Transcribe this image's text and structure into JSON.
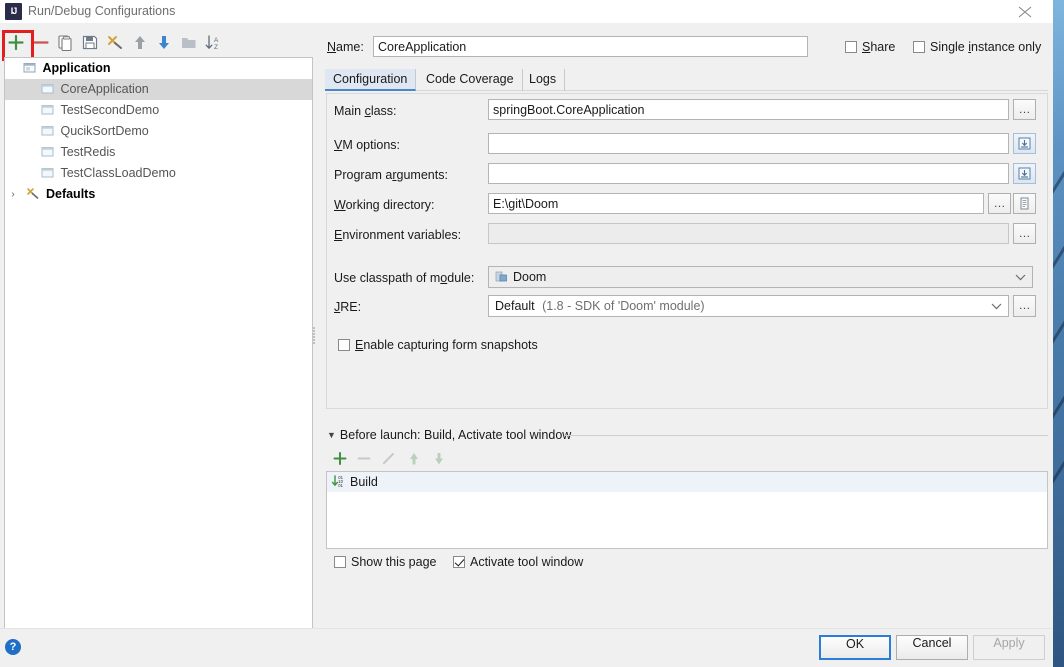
{
  "window": {
    "title": "Run/Debug Configurations",
    "app_icon": "intellij-idea-icon",
    "close_label": "×"
  },
  "tree_toolbar": {
    "buttons": [
      {
        "name": "add-configuration-button",
        "icon": "plus-icon",
        "color": "#3d9140"
      },
      {
        "name": "remove-configuration-button",
        "icon": "minus-icon",
        "color": "#c75450"
      },
      {
        "name": "copy-configuration-button",
        "icon": "copy-icon",
        "color": "#7a7a7a"
      },
      {
        "name": "save-configuration-button",
        "icon": "save-icon",
        "color": "#6e7b8b"
      },
      {
        "name": "edit-defaults-button",
        "icon": "wrench-icon",
        "color": "#d1a33a"
      },
      {
        "name": "move-up-button",
        "icon": "arrow-up-icon",
        "color": "#9aa0a6"
      },
      {
        "name": "move-down-button",
        "icon": "arrow-down-icon",
        "color": "#3b86d0"
      },
      {
        "name": "move-into-folder-button",
        "icon": "folder-icon",
        "color": "#9aa0a6"
      },
      {
        "name": "sort-configurations-button",
        "icon": "sort-az-icon",
        "color": "#5f6b77"
      }
    ]
  },
  "tree": {
    "groups": [
      {
        "label": "Application",
        "icon": "application-icon",
        "expanded": true,
        "children": [
          {
            "label": "CoreApplication",
            "icon": "run-config-icon",
            "selected": true
          },
          {
            "label": "TestSecondDemo",
            "icon": "run-config-icon",
            "selected": false
          },
          {
            "label": "QucikSortDemo",
            "icon": "run-config-icon",
            "selected": false
          },
          {
            "label": "TestRedis",
            "icon": "run-config-icon",
            "selected": false
          },
          {
            "label": "TestClassLoadDemo",
            "icon": "run-config-icon",
            "selected": false
          }
        ]
      }
    ],
    "defaults": {
      "label": "Defaults",
      "icon": "wrench-icon",
      "expanded": false,
      "twisty": "›"
    }
  },
  "header": {
    "name_label": "Name:",
    "name_value": "CoreApplication",
    "share_label": "Share",
    "share_checked": false,
    "single_instance_label": "Single instance only",
    "single_instance_checked": false
  },
  "tabs": [
    {
      "label": "Configuration",
      "active": true
    },
    {
      "label": "Code Coverage",
      "active": false
    },
    {
      "label": "Logs",
      "active": false
    }
  ],
  "configuration": {
    "main_class": {
      "label": "Main class:",
      "value": "springBoot.CoreApplication",
      "browse": "…"
    },
    "vm_options": {
      "label": "VM options:",
      "value": "",
      "expand_icon": "expand-editor-icon"
    },
    "program_arguments": {
      "label": "Program arguments:",
      "value": "",
      "expand_icon": "expand-editor-icon"
    },
    "working_directory": {
      "label": "Working directory:",
      "value": "E:\\git\\Doom",
      "browse": "…",
      "macro_icon": "insert-macro-icon"
    },
    "environment_variables": {
      "label": "Environment variables:",
      "value": "",
      "browse": "…"
    },
    "classpath_module": {
      "label": "Use classpath of module:",
      "value": "Doom",
      "icon": "module-icon",
      "arrow": "∨"
    },
    "jre": {
      "label": "JRE:",
      "value": "Default",
      "value_detail": "(1.8 - SDK of 'Doom' module)",
      "arrow": "∨",
      "browse": "…"
    },
    "form_snapshots": {
      "label": "Enable capturing form snapshots",
      "checked": false
    }
  },
  "before_launch": {
    "header": "Before launch: Build, Activate tool window",
    "twisty": "▼",
    "toolbar": [
      {
        "name": "add-task-button",
        "icon": "plus-icon",
        "enabled": true,
        "color": "#3d9140"
      },
      {
        "name": "remove-task-button",
        "icon": "minus-icon",
        "enabled": false,
        "color": "#c9c9c9"
      },
      {
        "name": "edit-task-button",
        "icon": "pencil-icon",
        "enabled": false,
        "color": "#c9c9c9"
      },
      {
        "name": "task-move-up-button",
        "icon": "arrow-up-icon",
        "enabled": false,
        "color": "#b9c6b9"
      },
      {
        "name": "task-move-down-button",
        "icon": "arrow-down-icon",
        "enabled": false,
        "color": "#b9c6b9"
      }
    ],
    "tasks": [
      {
        "label": "Build",
        "icon": "build-icon"
      }
    ],
    "show_page_label": "Show this page",
    "show_page_checked": false,
    "activate_tool_window_label": "Activate tool window",
    "activate_tool_window_checked": true
  },
  "footer": {
    "help_label": "?",
    "ok_label": "OK",
    "cancel_label": "Cancel",
    "apply_label": "Apply",
    "apply_enabled": false
  },
  "annotation": {
    "color": "#e21f1f",
    "target": "add-configuration-button"
  }
}
